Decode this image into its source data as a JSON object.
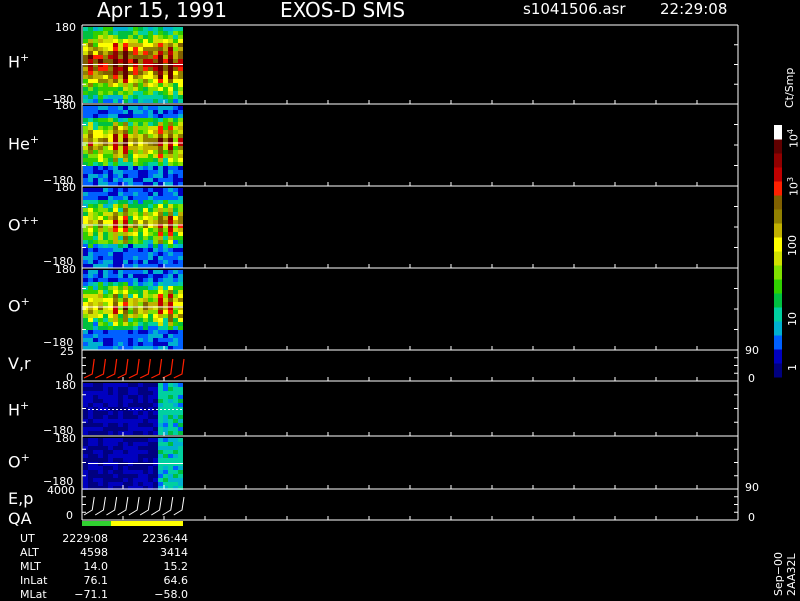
{
  "header": {
    "date": "Apr 15, 1991",
    "instrument": "EXOS-D SMS",
    "file": "s1041506.asr",
    "time": "22:29:08"
  },
  "panels": [
    {
      "label": "H",
      "sup": "+",
      "ymax": "180",
      "ymin": "−180"
    },
    {
      "label": "He",
      "sup": "+",
      "ymax": "180",
      "ymin": "−180"
    },
    {
      "label": "O",
      "sup": "++",
      "ymax": "180",
      "ymin": "−180"
    },
    {
      "label": "O",
      "sup": "+",
      "ymax": "180",
      "ymin": "−180"
    },
    {
      "label": "V,r",
      "sup": "",
      "ymax": "25",
      "ymin": "0",
      "rmax": "90",
      "rmin": "0"
    },
    {
      "label": "H",
      "sup": "+",
      "ymax": "180",
      "ymin": "−180"
    },
    {
      "label": "O",
      "sup": "+",
      "ymax": "180",
      "ymin": "−180"
    },
    {
      "label": "E,p",
      "sup": "",
      "label2": "QA",
      "ymax": "4000",
      "ymin": "0",
      "rmax": "90",
      "rmin": "0"
    }
  ],
  "colorbar": {
    "unit": "Ct/Smp",
    "ticks": [
      "1",
      "10",
      "100",
      "10",
      "10"
    ],
    "tick_sups": [
      "",
      "",
      "",
      "3",
      "4"
    ],
    "colors": [
      "#000080",
      "#0000c0",
      "#0060ff",
      "#00b0d0",
      "#00d0a0",
      "#00c040",
      "#30d000",
      "#80e000",
      "#d0e000",
      "#ffff00",
      "#c0b000",
      "#908000",
      "#806000",
      "#ff2000",
      "#c00000",
      "#900000",
      "#600000",
      "#ffffff"
    ]
  },
  "footer": {
    "rows": [
      {
        "name": "UT",
        "v1": "2229:08",
        "v2": "2236:44"
      },
      {
        "name": "ALT",
        "v1": "4598",
        "v2": "3414"
      },
      {
        "name": "MLT",
        "v1": "14.0",
        "v2": "15.2"
      },
      {
        "name": "InLat",
        "v1": "76.1",
        "v2": "64.6"
      },
      {
        "name": "MLat",
        "v1": "−71.1",
        "v2": "−58.0"
      }
    ],
    "version": "Sep−00 2AA32L"
  },
  "chart_data": {
    "type": "heatmap",
    "title": "Apr 15, 1991  EXOS-D SMS  s1041506.asr  22:29:08",
    "x_start": "2229:08",
    "x_end": "2236:44",
    "panels": [
      {
        "name": "H+",
        "ylim": [
          -180,
          180
        ]
      },
      {
        "name": "He+",
        "ylim": [
          -180,
          180
        ]
      },
      {
        "name": "O++",
        "ylim": [
          -180,
          180
        ]
      },
      {
        "name": "O+",
        "ylim": [
          -180,
          180
        ]
      },
      {
        "name": "V,r",
        "ylim": [
          0,
          25
        ],
        "right_ylim": [
          0,
          90
        ]
      },
      {
        "name": "H+",
        "ylim": [
          -180,
          180
        ]
      },
      {
        "name": "O+",
        "ylim": [
          -180,
          180
        ]
      },
      {
        "name": "E,p QA",
        "ylim": [
          0,
          4000
        ],
        "right_ylim": [
          0,
          90
        ]
      }
    ],
    "colorbar": {
      "label": "Ct/Smp",
      "scale": "log",
      "range": [
        1,
        10000
      ]
    },
    "spin_cycles": 9
  }
}
